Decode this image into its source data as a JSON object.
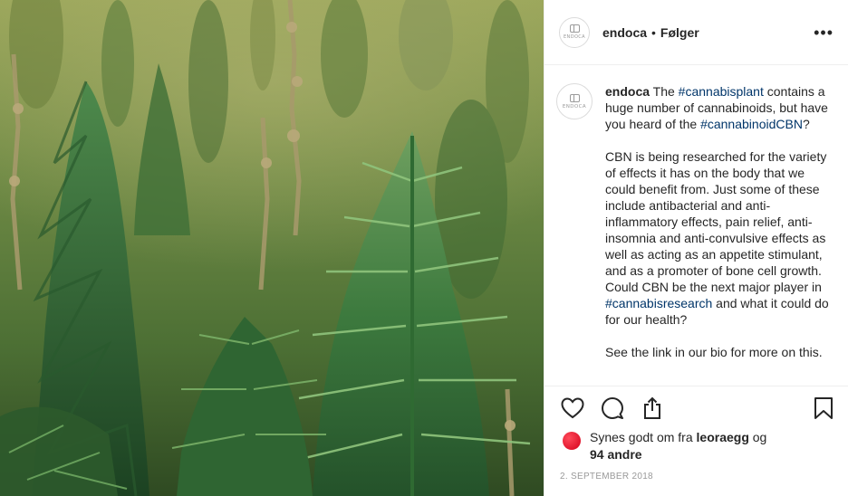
{
  "image": {
    "subject": "cannabis-field-photo"
  },
  "header": {
    "logo_text": "ENDOCA",
    "username": "endoca",
    "separator": "•",
    "follow_label": "Følger",
    "more_label": "•••"
  },
  "caption": {
    "username": "endoca",
    "t1": " The ",
    "tag1": "#cannabisplant",
    "t2": " contains a huge number of cannabinoids, but have you heard of the ",
    "tag2": "#cannabinoidCBN",
    "t3": "?",
    "p2": "CBN is being researched for the variety of effects it has on the body that we could benefit from. Just some of these include antibacterial and anti-inflammatory effects, pain relief, anti-insomnia and anti-convulsive effects as well as acting as an appetite stimulant, and as a promoter of bone cell growth.",
    "p3a": "Could CBN be the next major player in ",
    "tag3": "#cannabisresearch",
    "p3b": " and what it could do for our health?",
    "p4": "See the link in our bio for more on this."
  },
  "actions": {
    "like_icon": "heart-icon",
    "comment_icon": "comment-icon",
    "share_icon": "share-icon",
    "save_icon": "bookmark-icon"
  },
  "likes": {
    "prefix": "Synes godt om fra ",
    "user": "leoraegg",
    "middle": " og ",
    "count": "94 andre"
  },
  "date": "2. SEPTEMBER 2018",
  "colors": {
    "text": "#262626",
    "hashtag": "#003569",
    "border": "#efefef",
    "muted": "#999999",
    "liker_avatar": "#e8001c"
  }
}
